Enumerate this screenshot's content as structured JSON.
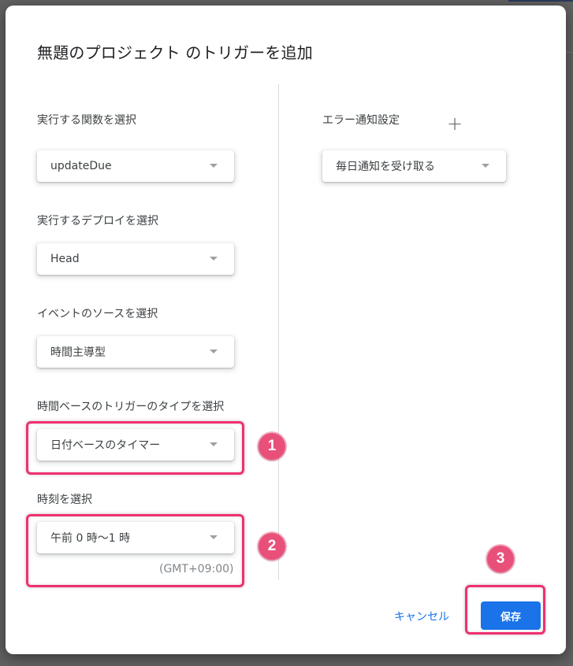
{
  "dialog": {
    "title": "無題のプロジェクト のトリガーを追加"
  },
  "left": {
    "function": {
      "label": "実行する関数を選択",
      "value": "updateDue"
    },
    "deployment": {
      "label": "実行するデプロイを選択",
      "value": "Head"
    },
    "event_source": {
      "label": "イベントのソースを選択",
      "value": "時間主導型"
    },
    "timer_type": {
      "label": "時間ベースのトリガーのタイプを選択",
      "value": "日付ベースのタイマー"
    },
    "time_of_day": {
      "label": "時刻を選択",
      "value": "午前 0 時〜1 時",
      "timezone": "(GMT+09:00)"
    }
  },
  "right": {
    "error_notify": {
      "label": "エラー通知設定",
      "add_icon": "plus-icon",
      "value": "毎日通知を受け取る"
    }
  },
  "footer": {
    "cancel_label": "キャンセル",
    "save_label": "保存"
  },
  "annotations": {
    "badges": [
      "1",
      "2",
      "3"
    ],
    "highlight_color": "#f0306e",
    "badge_color": "#e8507a"
  },
  "colors": {
    "primary": "#1a73e8",
    "backdrop": "#616161"
  }
}
